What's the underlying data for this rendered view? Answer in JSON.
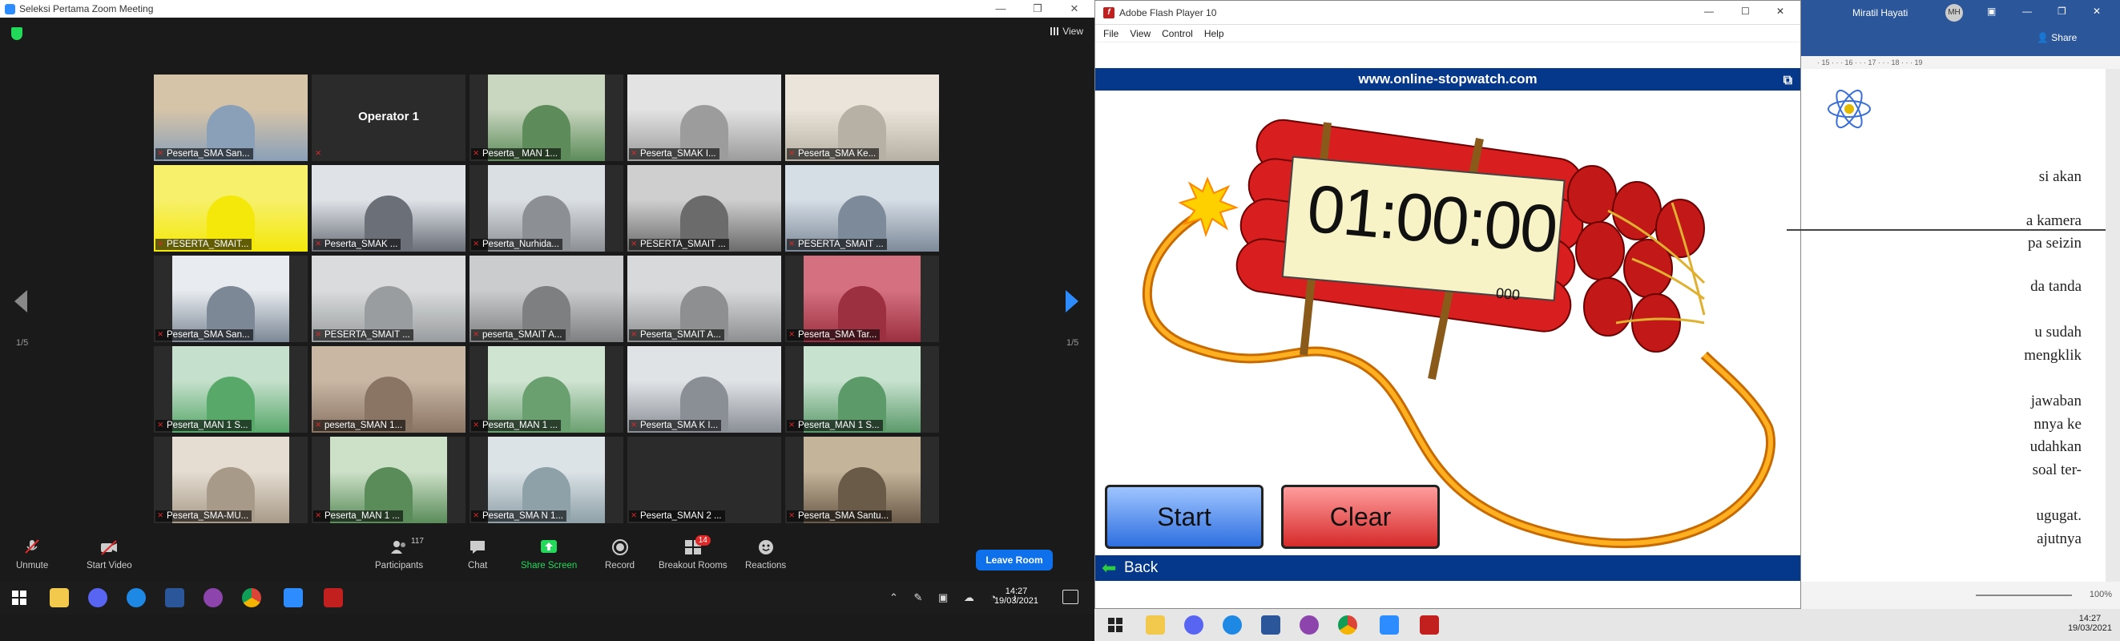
{
  "zoom": {
    "window_title": "Seleksi Pertama  Zoom Meeting",
    "view_label": "View",
    "page_left": "1/5",
    "page_right": "1/5",
    "operator_label": "Operator 1",
    "tiles": [
      "Peserta_SMA San...",
      "",
      "Peserta_ MAN 1...",
      "Peserta_SMAK I...",
      "Peserta_SMA Ke...",
      "PESERTA_SMAIT...",
      "Peserta_SMAK ...",
      "Peserta_Nurhida...",
      "PESERTA_SMAIT ...",
      "PESERTA_SMAIT ...",
      "Peserta_SMA San...",
      "PESERTA_SMAIT ...",
      "peserta_SMAIT A...",
      "Peserta_SMAIT A...",
      "Peserta_SMA Tar...",
      "Peserta_MAN 1 S...",
      "peserta_SMAN 1...",
      "Peserta_MAN 1 ...",
      "Peserta_SMA K I...",
      "Peserta_MAN 1 S...",
      "Peserta_SMA-MU...",
      "Peserta_MAN 1 ...",
      "Peserta_SMA N 1...",
      "Peserta_SMAN 2 ...",
      "Peserta_SMA Santu..."
    ],
    "toolbar": {
      "unmute": "Unmute",
      "start_video": "Start Video",
      "participants": "Participants",
      "participants_count": "117",
      "chat": "Chat",
      "share_screen": "Share Screen",
      "record": "Record",
      "breakout_rooms": "Breakout Rooms",
      "breakout_badge": "14",
      "reactions": "Reactions",
      "leave_room": "Leave Room"
    }
  },
  "taskbar1": {
    "time": "14:27",
    "date": "19/03/2021"
  },
  "flash": {
    "window_title": "Adobe Flash Player 10",
    "menu": [
      "File",
      "View",
      "Control",
      "Help"
    ],
    "url": "www.online-stopwatch.com",
    "timer": "01:00:00",
    "millis": "000",
    "start_label": "Start",
    "clear_label": "Clear",
    "back_label": "Back"
  },
  "word": {
    "user": "Miratil Hayati",
    "initials": "MH",
    "share_label": "Share",
    "ruler": "· 15 · · · 16 · · · 17 · · · 18 · · · 19",
    "lines": [
      "si   akan",
      "a kamera",
      "pa seizin",
      "da tanda",
      "u  sudah",
      "mengklik",
      "jawaban",
      "nnya ke",
      "udahkan",
      "soal ter-",
      "ugugat.",
      "ajutnya"
    ],
    "zoom": "100%"
  },
  "taskbar2": {
    "time": "14:27",
    "date": "19/03/2021"
  },
  "colors": {
    "zoom_blue": "#2d8cff",
    "flash_blue": "#05378a",
    "word_blue": "#2b579a",
    "dynamite_red": "#d81e1e"
  }
}
